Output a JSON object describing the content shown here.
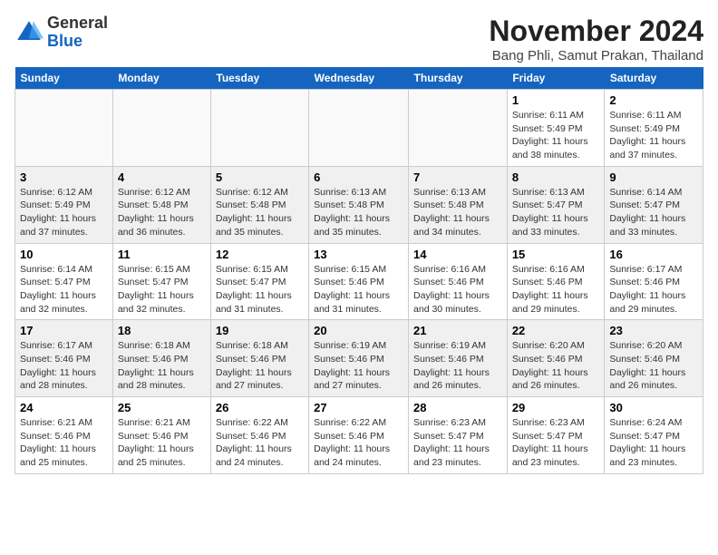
{
  "header": {
    "logo_general": "General",
    "logo_blue": "Blue",
    "month_title": "November 2024",
    "location": "Bang Phli, Samut Prakan, Thailand"
  },
  "weekdays": [
    "Sunday",
    "Monday",
    "Tuesday",
    "Wednesday",
    "Thursday",
    "Friday",
    "Saturday"
  ],
  "weeks": [
    [
      {
        "day": "",
        "info": ""
      },
      {
        "day": "",
        "info": ""
      },
      {
        "day": "",
        "info": ""
      },
      {
        "day": "",
        "info": ""
      },
      {
        "day": "",
        "info": ""
      },
      {
        "day": "1",
        "info": "Sunrise: 6:11 AM\nSunset: 5:49 PM\nDaylight: 11 hours and 38 minutes."
      },
      {
        "day": "2",
        "info": "Sunrise: 6:11 AM\nSunset: 5:49 PM\nDaylight: 11 hours and 37 minutes."
      }
    ],
    [
      {
        "day": "3",
        "info": "Sunrise: 6:12 AM\nSunset: 5:49 PM\nDaylight: 11 hours and 37 minutes."
      },
      {
        "day": "4",
        "info": "Sunrise: 6:12 AM\nSunset: 5:48 PM\nDaylight: 11 hours and 36 minutes."
      },
      {
        "day": "5",
        "info": "Sunrise: 6:12 AM\nSunset: 5:48 PM\nDaylight: 11 hours and 35 minutes."
      },
      {
        "day": "6",
        "info": "Sunrise: 6:13 AM\nSunset: 5:48 PM\nDaylight: 11 hours and 35 minutes."
      },
      {
        "day": "7",
        "info": "Sunrise: 6:13 AM\nSunset: 5:48 PM\nDaylight: 11 hours and 34 minutes."
      },
      {
        "day": "8",
        "info": "Sunrise: 6:13 AM\nSunset: 5:47 PM\nDaylight: 11 hours and 33 minutes."
      },
      {
        "day": "9",
        "info": "Sunrise: 6:14 AM\nSunset: 5:47 PM\nDaylight: 11 hours and 33 minutes."
      }
    ],
    [
      {
        "day": "10",
        "info": "Sunrise: 6:14 AM\nSunset: 5:47 PM\nDaylight: 11 hours and 32 minutes."
      },
      {
        "day": "11",
        "info": "Sunrise: 6:15 AM\nSunset: 5:47 PM\nDaylight: 11 hours and 32 minutes."
      },
      {
        "day": "12",
        "info": "Sunrise: 6:15 AM\nSunset: 5:47 PM\nDaylight: 11 hours and 31 minutes."
      },
      {
        "day": "13",
        "info": "Sunrise: 6:15 AM\nSunset: 5:46 PM\nDaylight: 11 hours and 31 minutes."
      },
      {
        "day": "14",
        "info": "Sunrise: 6:16 AM\nSunset: 5:46 PM\nDaylight: 11 hours and 30 minutes."
      },
      {
        "day": "15",
        "info": "Sunrise: 6:16 AM\nSunset: 5:46 PM\nDaylight: 11 hours and 29 minutes."
      },
      {
        "day": "16",
        "info": "Sunrise: 6:17 AM\nSunset: 5:46 PM\nDaylight: 11 hours and 29 minutes."
      }
    ],
    [
      {
        "day": "17",
        "info": "Sunrise: 6:17 AM\nSunset: 5:46 PM\nDaylight: 11 hours and 28 minutes."
      },
      {
        "day": "18",
        "info": "Sunrise: 6:18 AM\nSunset: 5:46 PM\nDaylight: 11 hours and 28 minutes."
      },
      {
        "day": "19",
        "info": "Sunrise: 6:18 AM\nSunset: 5:46 PM\nDaylight: 11 hours and 27 minutes."
      },
      {
        "day": "20",
        "info": "Sunrise: 6:19 AM\nSunset: 5:46 PM\nDaylight: 11 hours and 27 minutes."
      },
      {
        "day": "21",
        "info": "Sunrise: 6:19 AM\nSunset: 5:46 PM\nDaylight: 11 hours and 26 minutes."
      },
      {
        "day": "22",
        "info": "Sunrise: 6:20 AM\nSunset: 5:46 PM\nDaylight: 11 hours and 26 minutes."
      },
      {
        "day": "23",
        "info": "Sunrise: 6:20 AM\nSunset: 5:46 PM\nDaylight: 11 hours and 26 minutes."
      }
    ],
    [
      {
        "day": "24",
        "info": "Sunrise: 6:21 AM\nSunset: 5:46 PM\nDaylight: 11 hours and 25 minutes."
      },
      {
        "day": "25",
        "info": "Sunrise: 6:21 AM\nSunset: 5:46 PM\nDaylight: 11 hours and 25 minutes."
      },
      {
        "day": "26",
        "info": "Sunrise: 6:22 AM\nSunset: 5:46 PM\nDaylight: 11 hours and 24 minutes."
      },
      {
        "day": "27",
        "info": "Sunrise: 6:22 AM\nSunset: 5:46 PM\nDaylight: 11 hours and 24 minutes."
      },
      {
        "day": "28",
        "info": "Sunrise: 6:23 AM\nSunset: 5:47 PM\nDaylight: 11 hours and 23 minutes."
      },
      {
        "day": "29",
        "info": "Sunrise: 6:23 AM\nSunset: 5:47 PM\nDaylight: 11 hours and 23 minutes."
      },
      {
        "day": "30",
        "info": "Sunrise: 6:24 AM\nSunset: 5:47 PM\nDaylight: 11 hours and 23 minutes."
      }
    ]
  ]
}
